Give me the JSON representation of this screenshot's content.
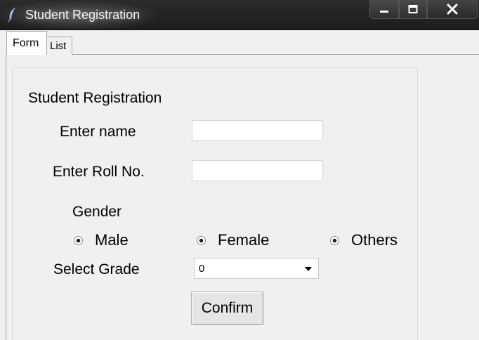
{
  "window": {
    "title": "Student Registration",
    "icon": "feather-icon",
    "controls": [
      "minimize-icon",
      "maximize-icon",
      "close-icon"
    ]
  },
  "tabs": [
    {
      "label": "Form",
      "selected": true
    },
    {
      "label": "List",
      "selected": false
    }
  ],
  "form": {
    "heading": "Student Registration",
    "name_label": "Enter name",
    "name_value": "",
    "roll_label": "Enter Roll No.",
    "roll_value": "",
    "gender_label": "Gender",
    "gender_options": [
      "Male",
      "Female",
      "Others"
    ],
    "grade_label": "Select Grade",
    "grade_value": "0",
    "confirm_label": "Confirm"
  },
  "colors": {
    "titlebar": "#1d1d1d",
    "window_bg": "#f0f0f0",
    "entry_bg": "#ffffff"
  }
}
